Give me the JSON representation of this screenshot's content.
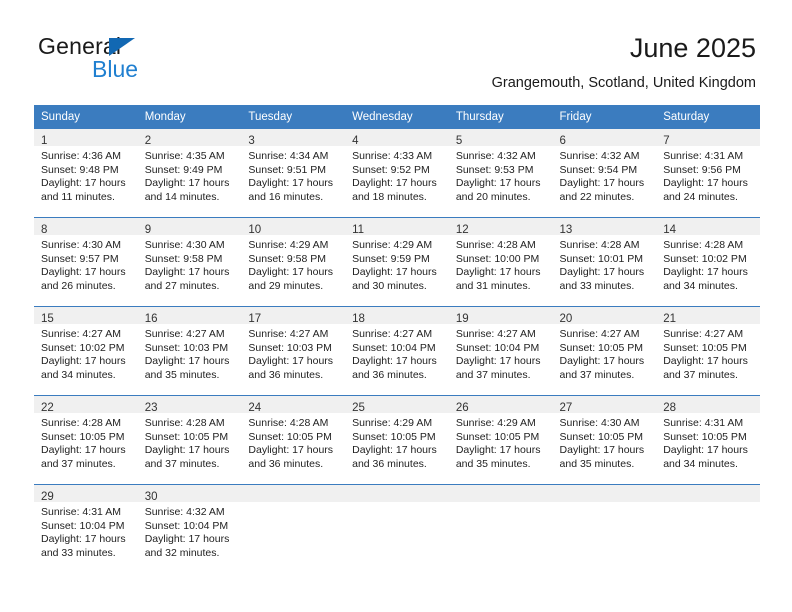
{
  "brand": {
    "name_part1": "General",
    "name_part2": "Blue",
    "accent_color": "#1268b3",
    "blue_text_color": "#1f7fd0"
  },
  "header": {
    "title": "June 2025",
    "subtitle": "Grangemouth, Scotland, United Kingdom",
    "header_bg": "#3b7cbf",
    "daynum_bg": "#f0f0f0"
  },
  "weekday_headers": [
    "Sunday",
    "Monday",
    "Tuesday",
    "Wednesday",
    "Thursday",
    "Friday",
    "Saturday"
  ],
  "labels": {
    "sunrise_prefix": "Sunrise:",
    "sunset_prefix": "Sunset:",
    "daylight_prefix": "Daylight:"
  },
  "weeks": [
    [
      {
        "day": "1",
        "sunrise": "Sunrise: 4:36 AM",
        "sunset": "Sunset: 9:48 PM",
        "daylight1": "Daylight: 17 hours",
        "daylight2": "and 11 minutes."
      },
      {
        "day": "2",
        "sunrise": "Sunrise: 4:35 AM",
        "sunset": "Sunset: 9:49 PM",
        "daylight1": "Daylight: 17 hours",
        "daylight2": "and 14 minutes."
      },
      {
        "day": "3",
        "sunrise": "Sunrise: 4:34 AM",
        "sunset": "Sunset: 9:51 PM",
        "daylight1": "Daylight: 17 hours",
        "daylight2": "and 16 minutes."
      },
      {
        "day": "4",
        "sunrise": "Sunrise: 4:33 AM",
        "sunset": "Sunset: 9:52 PM",
        "daylight1": "Daylight: 17 hours",
        "daylight2": "and 18 minutes."
      },
      {
        "day": "5",
        "sunrise": "Sunrise: 4:32 AM",
        "sunset": "Sunset: 9:53 PM",
        "daylight1": "Daylight: 17 hours",
        "daylight2": "and 20 minutes."
      },
      {
        "day": "6",
        "sunrise": "Sunrise: 4:32 AM",
        "sunset": "Sunset: 9:54 PM",
        "daylight1": "Daylight: 17 hours",
        "daylight2": "and 22 minutes."
      },
      {
        "day": "7",
        "sunrise": "Sunrise: 4:31 AM",
        "sunset": "Sunset: 9:56 PM",
        "daylight1": "Daylight: 17 hours",
        "daylight2": "and 24 minutes."
      }
    ],
    [
      {
        "day": "8",
        "sunrise": "Sunrise: 4:30 AM",
        "sunset": "Sunset: 9:57 PM",
        "daylight1": "Daylight: 17 hours",
        "daylight2": "and 26 minutes."
      },
      {
        "day": "9",
        "sunrise": "Sunrise: 4:30 AM",
        "sunset": "Sunset: 9:58 PM",
        "daylight1": "Daylight: 17 hours",
        "daylight2": "and 27 minutes."
      },
      {
        "day": "10",
        "sunrise": "Sunrise: 4:29 AM",
        "sunset": "Sunset: 9:58 PM",
        "daylight1": "Daylight: 17 hours",
        "daylight2": "and 29 minutes."
      },
      {
        "day": "11",
        "sunrise": "Sunrise: 4:29 AM",
        "sunset": "Sunset: 9:59 PM",
        "daylight1": "Daylight: 17 hours",
        "daylight2": "and 30 minutes."
      },
      {
        "day": "12",
        "sunrise": "Sunrise: 4:28 AM",
        "sunset": "Sunset: 10:00 PM",
        "daylight1": "Daylight: 17 hours",
        "daylight2": "and 31 minutes."
      },
      {
        "day": "13",
        "sunrise": "Sunrise: 4:28 AM",
        "sunset": "Sunset: 10:01 PM",
        "daylight1": "Daylight: 17 hours",
        "daylight2": "and 33 minutes."
      },
      {
        "day": "14",
        "sunrise": "Sunrise: 4:28 AM",
        "sunset": "Sunset: 10:02 PM",
        "daylight1": "Daylight: 17 hours",
        "daylight2": "and 34 minutes."
      }
    ],
    [
      {
        "day": "15",
        "sunrise": "Sunrise: 4:27 AM",
        "sunset": "Sunset: 10:02 PM",
        "daylight1": "Daylight: 17 hours",
        "daylight2": "and 34 minutes."
      },
      {
        "day": "16",
        "sunrise": "Sunrise: 4:27 AM",
        "sunset": "Sunset: 10:03 PM",
        "daylight1": "Daylight: 17 hours",
        "daylight2": "and 35 minutes."
      },
      {
        "day": "17",
        "sunrise": "Sunrise: 4:27 AM",
        "sunset": "Sunset: 10:03 PM",
        "daylight1": "Daylight: 17 hours",
        "daylight2": "and 36 minutes."
      },
      {
        "day": "18",
        "sunrise": "Sunrise: 4:27 AM",
        "sunset": "Sunset: 10:04 PM",
        "daylight1": "Daylight: 17 hours",
        "daylight2": "and 36 minutes."
      },
      {
        "day": "19",
        "sunrise": "Sunrise: 4:27 AM",
        "sunset": "Sunset: 10:04 PM",
        "daylight1": "Daylight: 17 hours",
        "daylight2": "and 37 minutes."
      },
      {
        "day": "20",
        "sunrise": "Sunrise: 4:27 AM",
        "sunset": "Sunset: 10:05 PM",
        "daylight1": "Daylight: 17 hours",
        "daylight2": "and 37 minutes."
      },
      {
        "day": "21",
        "sunrise": "Sunrise: 4:27 AM",
        "sunset": "Sunset: 10:05 PM",
        "daylight1": "Daylight: 17 hours",
        "daylight2": "and 37 minutes."
      }
    ],
    [
      {
        "day": "22",
        "sunrise": "Sunrise: 4:28 AM",
        "sunset": "Sunset: 10:05 PM",
        "daylight1": "Daylight: 17 hours",
        "daylight2": "and 37 minutes."
      },
      {
        "day": "23",
        "sunrise": "Sunrise: 4:28 AM",
        "sunset": "Sunset: 10:05 PM",
        "daylight1": "Daylight: 17 hours",
        "daylight2": "and 37 minutes."
      },
      {
        "day": "24",
        "sunrise": "Sunrise: 4:28 AM",
        "sunset": "Sunset: 10:05 PM",
        "daylight1": "Daylight: 17 hours",
        "daylight2": "and 36 minutes."
      },
      {
        "day": "25",
        "sunrise": "Sunrise: 4:29 AM",
        "sunset": "Sunset: 10:05 PM",
        "daylight1": "Daylight: 17 hours",
        "daylight2": "and 36 minutes."
      },
      {
        "day": "26",
        "sunrise": "Sunrise: 4:29 AM",
        "sunset": "Sunset: 10:05 PM",
        "daylight1": "Daylight: 17 hours",
        "daylight2": "and 35 minutes."
      },
      {
        "day": "27",
        "sunrise": "Sunrise: 4:30 AM",
        "sunset": "Sunset: 10:05 PM",
        "daylight1": "Daylight: 17 hours",
        "daylight2": "and 35 minutes."
      },
      {
        "day": "28",
        "sunrise": "Sunrise: 4:31 AM",
        "sunset": "Sunset: 10:05 PM",
        "daylight1": "Daylight: 17 hours",
        "daylight2": "and 34 minutes."
      }
    ],
    [
      {
        "day": "29",
        "sunrise": "Sunrise: 4:31 AM",
        "sunset": "Sunset: 10:04 PM",
        "daylight1": "Daylight: 17 hours",
        "daylight2": "and 33 minutes."
      },
      {
        "day": "30",
        "sunrise": "Sunrise: 4:32 AM",
        "sunset": "Sunset: 10:04 PM",
        "daylight1": "Daylight: 17 hours",
        "daylight2": "and 32 minutes."
      },
      {
        "day": "",
        "sunrise": "",
        "sunset": "",
        "daylight1": "",
        "daylight2": ""
      },
      {
        "day": "",
        "sunrise": "",
        "sunset": "",
        "daylight1": "",
        "daylight2": ""
      },
      {
        "day": "",
        "sunrise": "",
        "sunset": "",
        "daylight1": "",
        "daylight2": ""
      },
      {
        "day": "",
        "sunrise": "",
        "sunset": "",
        "daylight1": "",
        "daylight2": ""
      },
      {
        "day": "",
        "sunrise": "",
        "sunset": "",
        "daylight1": "",
        "daylight2": ""
      }
    ]
  ]
}
